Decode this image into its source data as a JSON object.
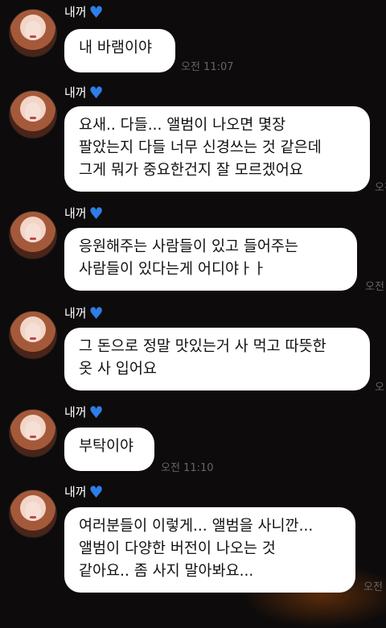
{
  "messages": [
    {
      "sender": "내꺼",
      "lines": [
        "내 바램이야"
      ],
      "time": "오전 11:07"
    },
    {
      "sender": "내꺼",
      "lines": [
        "요새.. 다들... 앨범이 나오면 몇장",
        "팔았는지 다들 너무 신경쓰는 것 같은데",
        "그게 뭐가 중요한건지 잘 모르겠어요"
      ],
      "time": "오전"
    },
    {
      "sender": "내꺼",
      "lines": [
        "응원해주는 사람들이 있고 들어주는",
        "사람들이 있다는게 어디야ㅏㅏ"
      ],
      "time": "오전"
    },
    {
      "sender": "내꺼",
      "lines": [
        "그 돈으로 정말 맛있는거 사 먹고 따뜻한",
        "옷 사 입어요"
      ],
      "time": "오"
    },
    {
      "sender": "내꺼",
      "lines": [
        "부탁이야"
      ],
      "time": "오전 11:10"
    },
    {
      "sender": "내꺼",
      "lines": [
        "여러분들이 이렇게... 앨범을 사니깐...",
        "앨범이 다양한 버전이 나오는 것",
        "같아요.. 좀 사지 말아봐요..."
      ],
      "time": "오전"
    }
  ],
  "icons": {
    "heart": "blue-heart-icon",
    "avatar": "profile-avatar"
  },
  "colors": {
    "background": "#0d0b0b",
    "bubble": "#ffffff",
    "heart": "#2f7de6",
    "time": "#6a6363"
  }
}
